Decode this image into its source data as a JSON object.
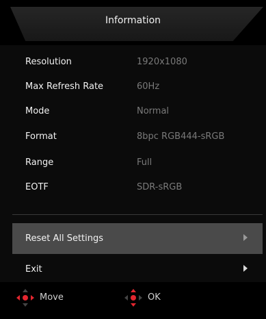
{
  "title": "Information",
  "info": [
    {
      "label": "Resolution",
      "value": "1920x1080"
    },
    {
      "label": "Max Refresh Rate",
      "value": "60Hz"
    },
    {
      "label": "Mode",
      "value": "Normal"
    },
    {
      "label": "Format",
      "value": "8bpc RGB444-sRGB"
    },
    {
      "label": "Range",
      "value": "Full"
    },
    {
      "label": "EOTF",
      "value": "SDR-sRGB"
    }
  ],
  "menu": [
    {
      "label": "Reset All Settings",
      "selected": true
    },
    {
      "label": "Exit",
      "selected": false
    }
  ],
  "footer": {
    "move_label": "Move",
    "move_icon": "left-right-dpad-icon",
    "ok_label": "OK",
    "ok_icon": "up-down-dpad-icon"
  },
  "colors": {
    "accent": "#e3262f",
    "selected_bg": "#4a4a4a",
    "value_text": "#7a7a7a"
  }
}
